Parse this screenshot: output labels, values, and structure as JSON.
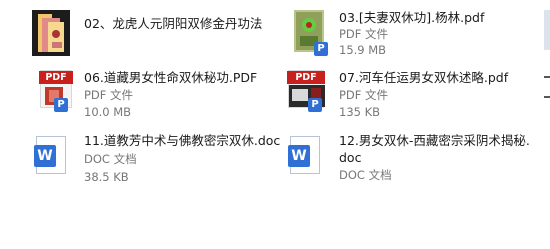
{
  "files": [
    {
      "name": "02、龙虎人元阴阳双修金丹功法",
      "type": "",
      "size": ""
    },
    {
      "name": "03.[夫妻双休功].杨林.pdf",
      "type": "PDF 文件",
      "size": "15.9 MB"
    },
    {
      "name": "06.道藏男女性命双休秘功.PDF",
      "type": "PDF 文件",
      "size": "10.0 MB"
    },
    {
      "name": "07.河车任运男女双休述略.pdf",
      "type": "PDF 文件",
      "size": "135 KB"
    },
    {
      "name": "11.道教芳中术与佛教密宗双休.doc",
      "type": "DOC 文档",
      "size": "38.5 KB"
    },
    {
      "name_line1": "12.男女双休-西藏密宗采阴术揭秘.",
      "name_line2": "doc",
      "type": "DOC 文档"
    }
  ],
  "icons": {
    "pdf_label": "PDF",
    "badge_letter": "P",
    "word_letter": "W"
  },
  "colors": {
    "pdf_red": "#c8201d",
    "word_blue": "#2f6fd6",
    "meta_gray": "#777777"
  }
}
